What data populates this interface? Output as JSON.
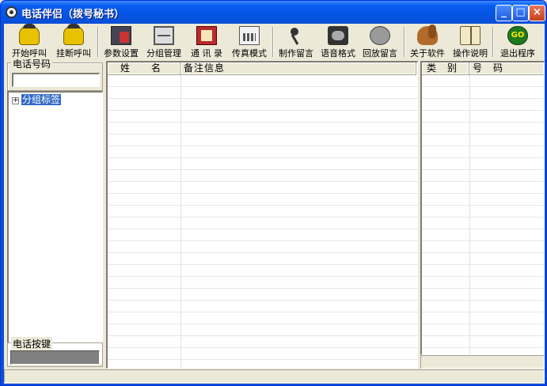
{
  "window": {
    "title": "电话伴侣（拨号秘书）"
  },
  "toolbar": {
    "items": [
      {
        "label": "开始呼叫",
        "icon": "phone-dial-icon"
      },
      {
        "label": "挂断呼叫",
        "icon": "phone-hangup-icon"
      },
      {
        "label": "参数设置",
        "icon": "settings-icon"
      },
      {
        "label": "分组管理",
        "icon": "cabinet-icon"
      },
      {
        "label": "通 讯 录",
        "icon": "address-book-icon"
      },
      {
        "label": "传真模式",
        "icon": "fax-icon"
      },
      {
        "label": "制作留言",
        "icon": "microphone-icon"
      },
      {
        "label": "语音格式",
        "icon": "tape-icon"
      },
      {
        "label": "回放留言",
        "icon": "speaker-icon"
      },
      {
        "label": "关于软件",
        "icon": "squirrel-icon"
      },
      {
        "label": "操作说明",
        "icon": "open-book-icon"
      },
      {
        "label": "退出程序",
        "icon": "go-icon",
        "icon_text": "GO"
      }
    ]
  },
  "left": {
    "phone_group_title": "电话号码",
    "phone_value": "",
    "tree_root": "分组标签",
    "tree_expander": "+",
    "keypad_group_title": "电话按键"
  },
  "contacts": {
    "columns": [
      "姓　　名",
      "备注信息"
    ]
  },
  "numbers": {
    "columns": [
      "类　别",
      "号　码"
    ]
  },
  "colors": {
    "title_bar": "#0A4FD6",
    "face": "#ECE9D8",
    "selection": "#316AC5"
  }
}
